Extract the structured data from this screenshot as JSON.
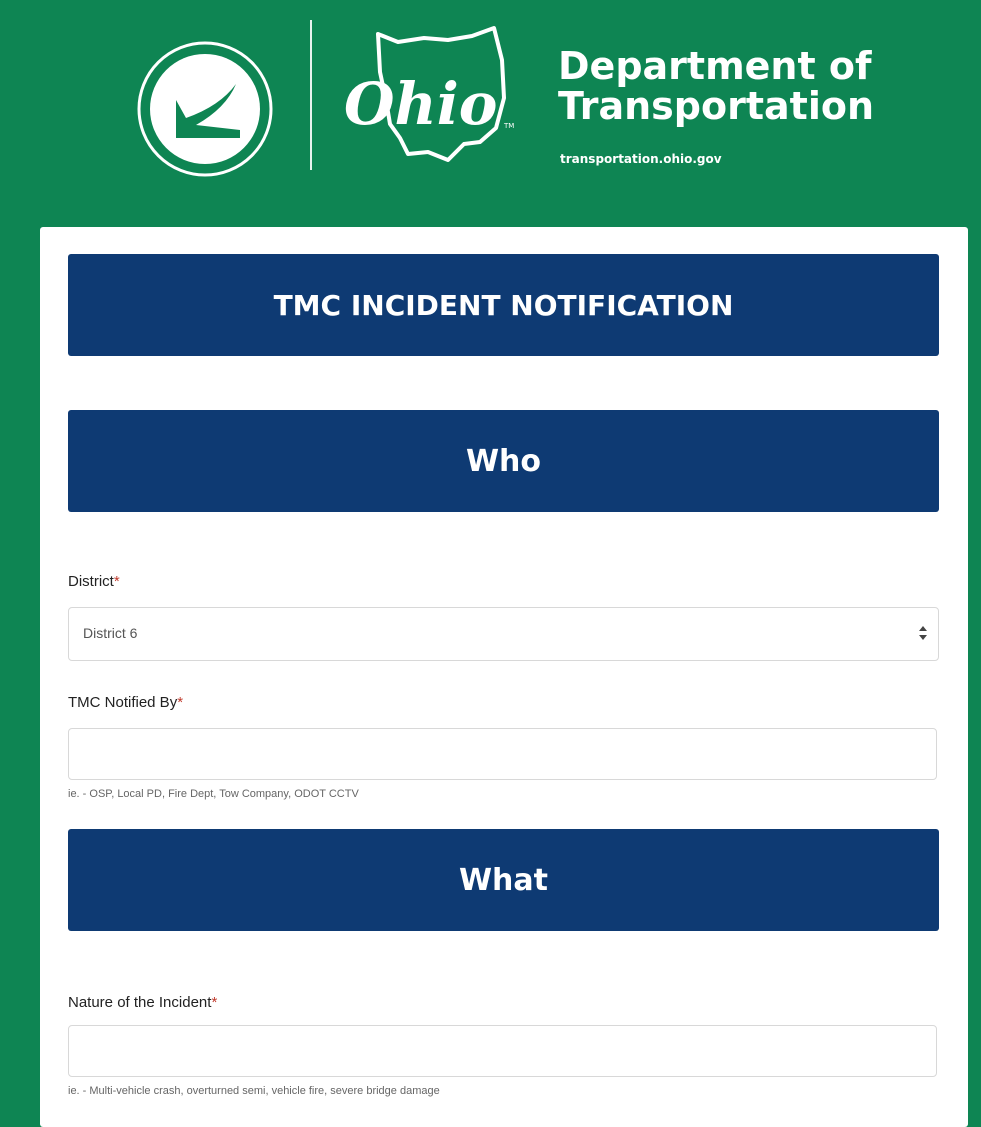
{
  "header": {
    "logo_wordmark": "Ohio",
    "logo_tm": "TM",
    "title_line1": "Department of",
    "title_line2": "Transportation",
    "url": "transportation.ohio.gov"
  },
  "form": {
    "title": "TMC INCIDENT NOTIFICATION",
    "sections": {
      "who": "Who",
      "what": "What"
    },
    "fields": {
      "district": {
        "label": "District",
        "required_mark": "*",
        "value": "District 6"
      },
      "notified_by": {
        "label": "TMC Notified By",
        "required_mark": "*",
        "value": "",
        "hint": "ie. - OSP, Local PD, Fire Dept, Tow Company, ODOT CCTV"
      },
      "nature": {
        "label": "Nature of the Incident",
        "required_mark": "*",
        "value": "",
        "hint": "ie. - Multi-vehicle crash, overturned semi, vehicle fire, severe bridge damage"
      }
    }
  },
  "colors": {
    "background_green": "#0e8553",
    "banner_navy": "#0e3a73",
    "required_red": "#c0392b"
  },
  "icons": [
    "odot-circle-logo",
    "ohio-state-outline-logo",
    "select-arrows-icon"
  ]
}
